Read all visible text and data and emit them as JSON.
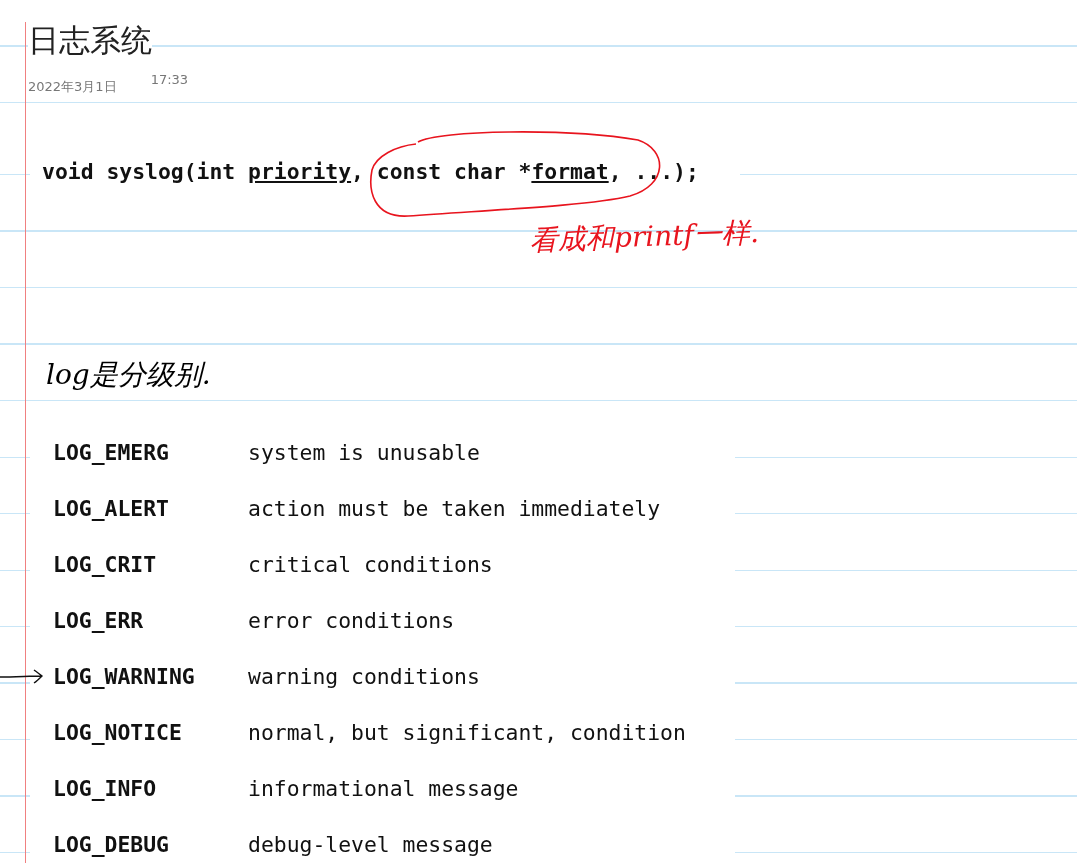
{
  "page": {
    "title": "日志系统",
    "date": "2022年3月1日",
    "time": "17:33"
  },
  "code_snippet": {
    "segments": [
      {
        "text": "void syslog(int ",
        "underlined": false
      },
      {
        "text": "priority",
        "underlined": true
      },
      {
        "text": ", const char *",
        "underlined": false
      },
      {
        "text": "format",
        "underlined": true
      },
      {
        "text": ", ...);",
        "underlined": false
      }
    ]
  },
  "ink_notes": [
    {
      "text": "看成和printf一样.",
      "color": "#e8141e"
    },
    {
      "text": "log是分级别.",
      "color": "#000000"
    }
  ],
  "log_levels": [
    {
      "name": "LOG_EMERG",
      "description": "system is unusable",
      "marked": false
    },
    {
      "name": "LOG_ALERT",
      "description": "action must be taken immediately",
      "marked": false
    },
    {
      "name": "LOG_CRIT",
      "description": "critical conditions",
      "marked": false
    },
    {
      "name": "LOG_ERR",
      "description": "error conditions",
      "marked": false
    },
    {
      "name": "LOG_WARNING",
      "description": "warning conditions",
      "marked": true
    },
    {
      "name": "LOG_NOTICE",
      "description": "normal, but significant, condition",
      "marked": false
    },
    {
      "name": "LOG_INFO",
      "description": "informational message",
      "marked": false
    },
    {
      "name": "LOG_DEBUG",
      "description": "debug-level message",
      "marked": false
    }
  ]
}
